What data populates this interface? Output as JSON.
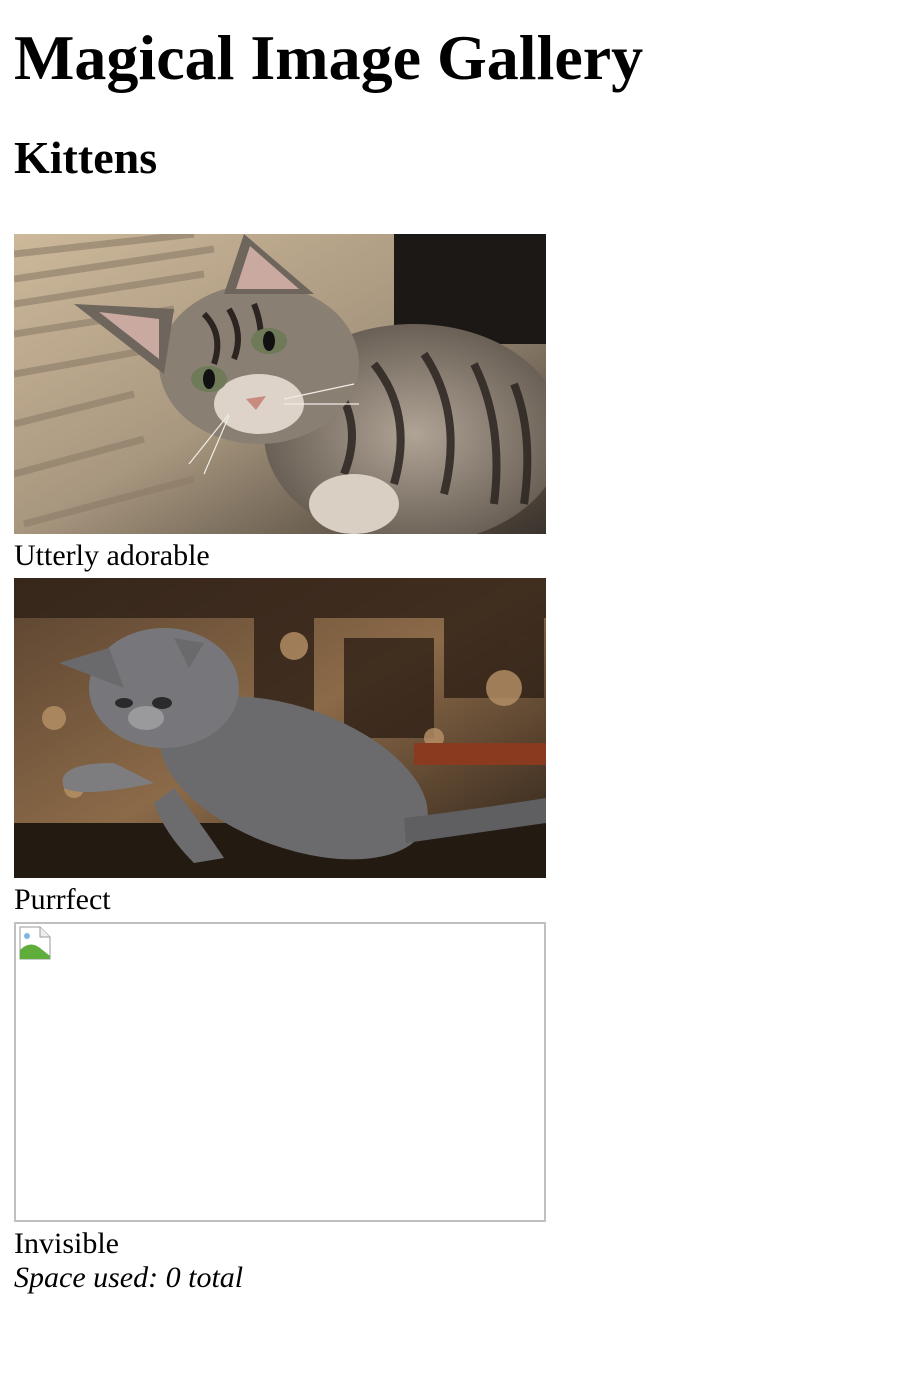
{
  "page": {
    "title": "Magical Image Gallery",
    "section_title": "Kittens"
  },
  "gallery": {
    "items": [
      {
        "caption": "Utterly adorable",
        "image": "tabby-kitten-photo"
      },
      {
        "caption": "Purrfect",
        "image": "grey-kitten-photo"
      },
      {
        "caption": "Invisible",
        "image": "broken-image-placeholder"
      }
    ]
  },
  "footer": {
    "space_used": "Space used: 0 total"
  }
}
